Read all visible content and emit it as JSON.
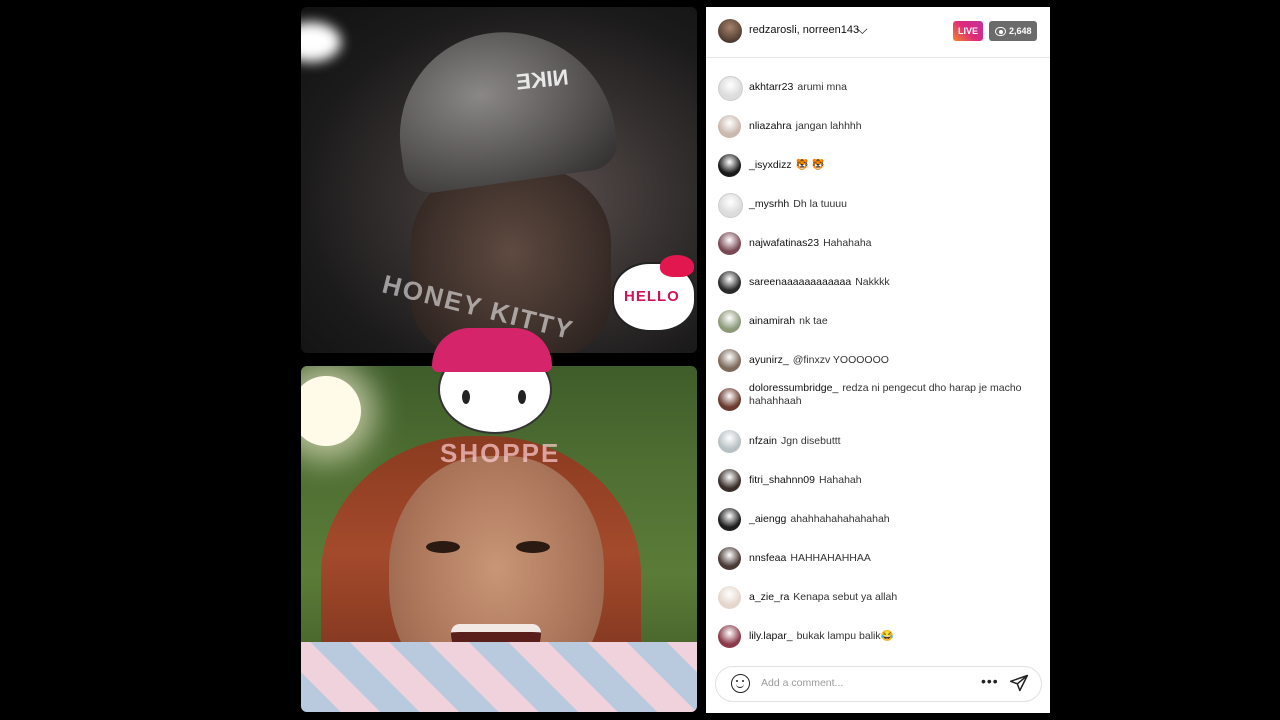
{
  "header": {
    "names": "redzarosli, norreen143",
    "live_label": "LIVE",
    "viewer_count": "2,648"
  },
  "overlay": {
    "sticker_text": "HELLO",
    "watermark_brand": "HONEY KITTY",
    "watermark_sub": "SHOPPE",
    "cap_logo": "NIKE"
  },
  "comments": [
    {
      "user": "akhtarr23",
      "text": "arumi mna",
      "avatar": "#dcdcdc"
    },
    {
      "user": "nliazahra",
      "text": "jangan lahhhh",
      "avatar": "#c9b8ad"
    },
    {
      "user": "_isyxdizz",
      "text": "🐯 🐯",
      "avatar": "#1a1a1a"
    },
    {
      "user": "_mysrhh",
      "text": "Dh la tuuuu",
      "avatar": "#dcdcdc"
    },
    {
      "user": "najwafatinas23",
      "text": "Hahahaha",
      "avatar": "#7a4a54"
    },
    {
      "user": "sareenaaaaaaaaaaaa",
      "text": "Nakkkk",
      "avatar": "#2a2a2a"
    },
    {
      "user": "ainamirah",
      "text": "nk tae",
      "avatar": "#8d9a7a"
    },
    {
      "user": "ayunirz_",
      "text": "@finxzv YOOOOOO",
      "avatar": "#7d6a5c"
    },
    {
      "user": "doloressumbridge_",
      "text": "redza ni pengecut dho harap je macho hahahhaah",
      "avatar": "#6b3a2e"
    },
    {
      "user": "nfzain",
      "text": "Jgn disebuttt",
      "avatar": "#b8c0c4"
    },
    {
      "user": "fitri_shahnn09",
      "text": "Hahahah",
      "avatar": "#3a2e2a"
    },
    {
      "user": "_aiengg",
      "text": "ahahhahahahahahah",
      "avatar": "#1e1e1e"
    },
    {
      "user": "nnsfeaa",
      "text": "HAHHAHAHHAA",
      "avatar": "#4a3a35"
    },
    {
      "user": "a_zie_ra",
      "text": "Kenapa sebut ya allah",
      "avatar": "#e5d6cc"
    },
    {
      "user": "lily.lapar_",
      "text": "bukak lampu balik😂",
      "avatar": "#8a3a4a"
    }
  ],
  "comment_box": {
    "placeholder": "Add a comment...",
    "more_label": "•••"
  }
}
